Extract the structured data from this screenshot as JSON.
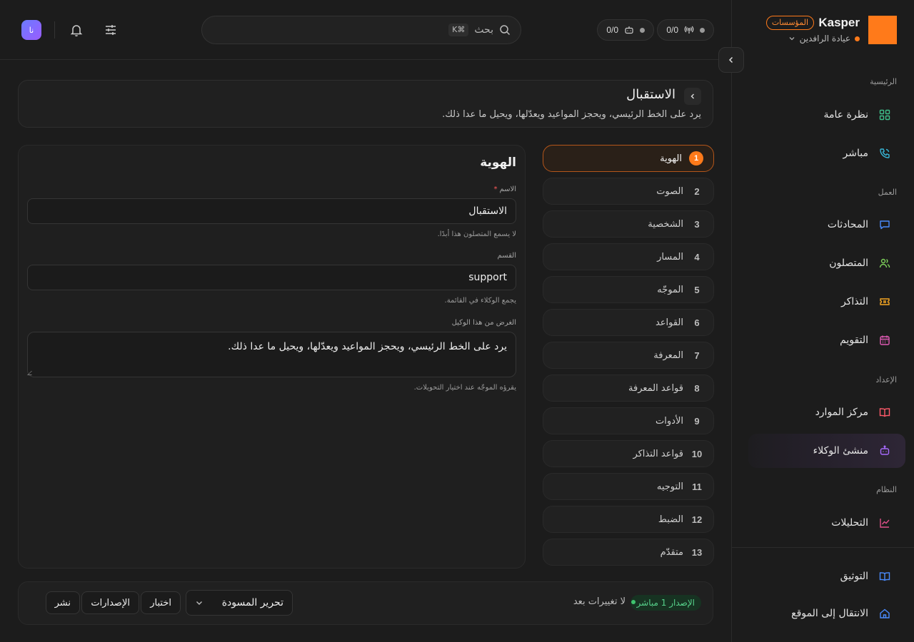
{
  "brand": {
    "name": "Kasper",
    "badge": "المؤسسات",
    "org": "عيادة الرافدين",
    "accent": "#ff7a1a"
  },
  "topbar": {
    "stats": [
      {
        "value": "0/0",
        "icon": "broadcast-icon"
      },
      {
        "value": "0/0",
        "icon": "bot-icon"
      }
    ],
    "search": {
      "label": "بحث",
      "shortcut": "⌘K"
    },
    "avatar": "نا"
  },
  "sidebar": {
    "sections": [
      {
        "title": "الرئيسية"
      },
      {
        "title": "العمل"
      },
      {
        "title": "الإعداد"
      },
      {
        "title": "النظام"
      }
    ],
    "items": [
      {
        "label": "نظرة عامة",
        "icon": "grid-icon",
        "color": "#3fbf8a"
      },
      {
        "label": "مباشر",
        "icon": "phone-icon",
        "color": "#38b6d6"
      },
      {
        "label": "المحادثات",
        "icon": "chat-icon",
        "color": "#4a8cff"
      },
      {
        "label": "المتصلون",
        "icon": "users-icon",
        "color": "#7dd05a"
      },
      {
        "label": "التذاكر",
        "icon": "ticket-icon",
        "color": "#f5a623"
      },
      {
        "label": "التقويم",
        "icon": "calendar-icon",
        "color": "#e05ab4"
      },
      {
        "label": "مركز الموارد",
        "icon": "book-icon",
        "color": "#ff5a6a"
      },
      {
        "label": "منشئ الوكلاء",
        "icon": "bot-icon",
        "color": "#a86bff"
      },
      {
        "label": "التحليلات",
        "icon": "chart-icon",
        "color": "#e0508a"
      }
    ],
    "footer": [
      {
        "label": "التوثيق",
        "icon": "docs-icon",
        "color": "#4a8cff"
      },
      {
        "label": "الانتقال إلى الموقع",
        "icon": "home-icon",
        "color": "#4a8cff"
      }
    ]
  },
  "header": {
    "title": "الاستقبال",
    "description": "يرد على الخط الرئيسي، ويحجز المواعيد ويعدّلها، ويحيل ما عدا ذلك."
  },
  "steps": [
    {
      "num": "1",
      "label": "الهوية"
    },
    {
      "num": "2",
      "label": "الصوت"
    },
    {
      "num": "3",
      "label": "الشخصية"
    },
    {
      "num": "4",
      "label": "المسار"
    },
    {
      "num": "5",
      "label": "الموجّه"
    },
    {
      "num": "6",
      "label": "القواعد"
    },
    {
      "num": "7",
      "label": "المعرفة"
    },
    {
      "num": "8",
      "label": "قواعد المعرفة"
    },
    {
      "num": "9",
      "label": "الأدوات"
    },
    {
      "num": "10",
      "label": "قواعد التذاكر"
    },
    {
      "num": "11",
      "label": "التوجيه"
    },
    {
      "num": "12",
      "label": "الضبط"
    },
    {
      "num": "13",
      "label": "متقدّم"
    }
  ],
  "form": {
    "title": "الهوية",
    "name": {
      "label": "الاسم",
      "required": "*",
      "value": "الاستقبال",
      "help": "لا يسمع المتصلون هذا أبدًا."
    },
    "department": {
      "label": "القسم",
      "value": "support",
      "help": "يجمع الوكلاء في القائمة."
    },
    "purpose": {
      "label": "الغرض من هذا الوكيل",
      "value": "يرد على الخط الرئيسي، ويحجز المواعيد ويعدّلها، ويحيل ما عدا ذلك.",
      "help": "يقرؤه الموجّه عند اختيار التحويلات."
    }
  },
  "footer": {
    "version": "الإصدار 1 مباشر",
    "status": "لا تغييرات بعد",
    "draft_select": "تحرير المسودة",
    "test": "اختبار",
    "versions": "الإصدارات",
    "publish": "نشر"
  }
}
